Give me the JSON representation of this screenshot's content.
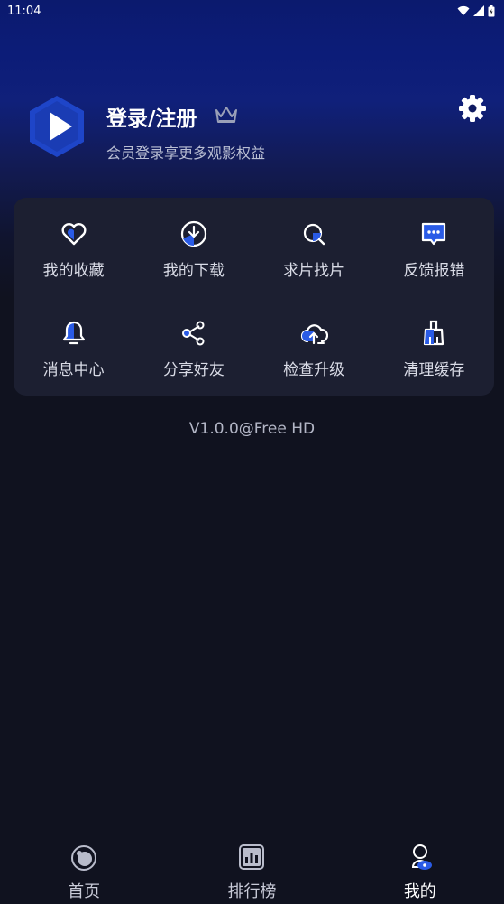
{
  "status_bar": {
    "time": "11:04"
  },
  "profile": {
    "title": "登录/注册",
    "subtitle": "会员登录享更多观影权益"
  },
  "menu": [
    {
      "label": "我的收藏",
      "icon": "heart-icon"
    },
    {
      "label": "我的下载",
      "icon": "download-icon"
    },
    {
      "label": "求片找片",
      "icon": "search-icon"
    },
    {
      "label": "反馈报错",
      "icon": "feedback-icon"
    },
    {
      "label": "消息中心",
      "icon": "bell-icon"
    },
    {
      "label": "分享好友",
      "icon": "share-icon"
    },
    {
      "label": "检查升级",
      "icon": "cloud-upload-icon"
    },
    {
      "label": "清理缓存",
      "icon": "broom-icon"
    }
  ],
  "version": "V1.0.0@Free HD",
  "tabs": [
    {
      "label": "首页",
      "icon": "home-icon"
    },
    {
      "label": "排行榜",
      "icon": "ranking-icon"
    },
    {
      "label": "我的",
      "icon": "profile-icon",
      "active": true
    }
  ],
  "colors": {
    "accent": "#1f4fd8",
    "card": "#1c1f31",
    "background": "#10121f"
  }
}
